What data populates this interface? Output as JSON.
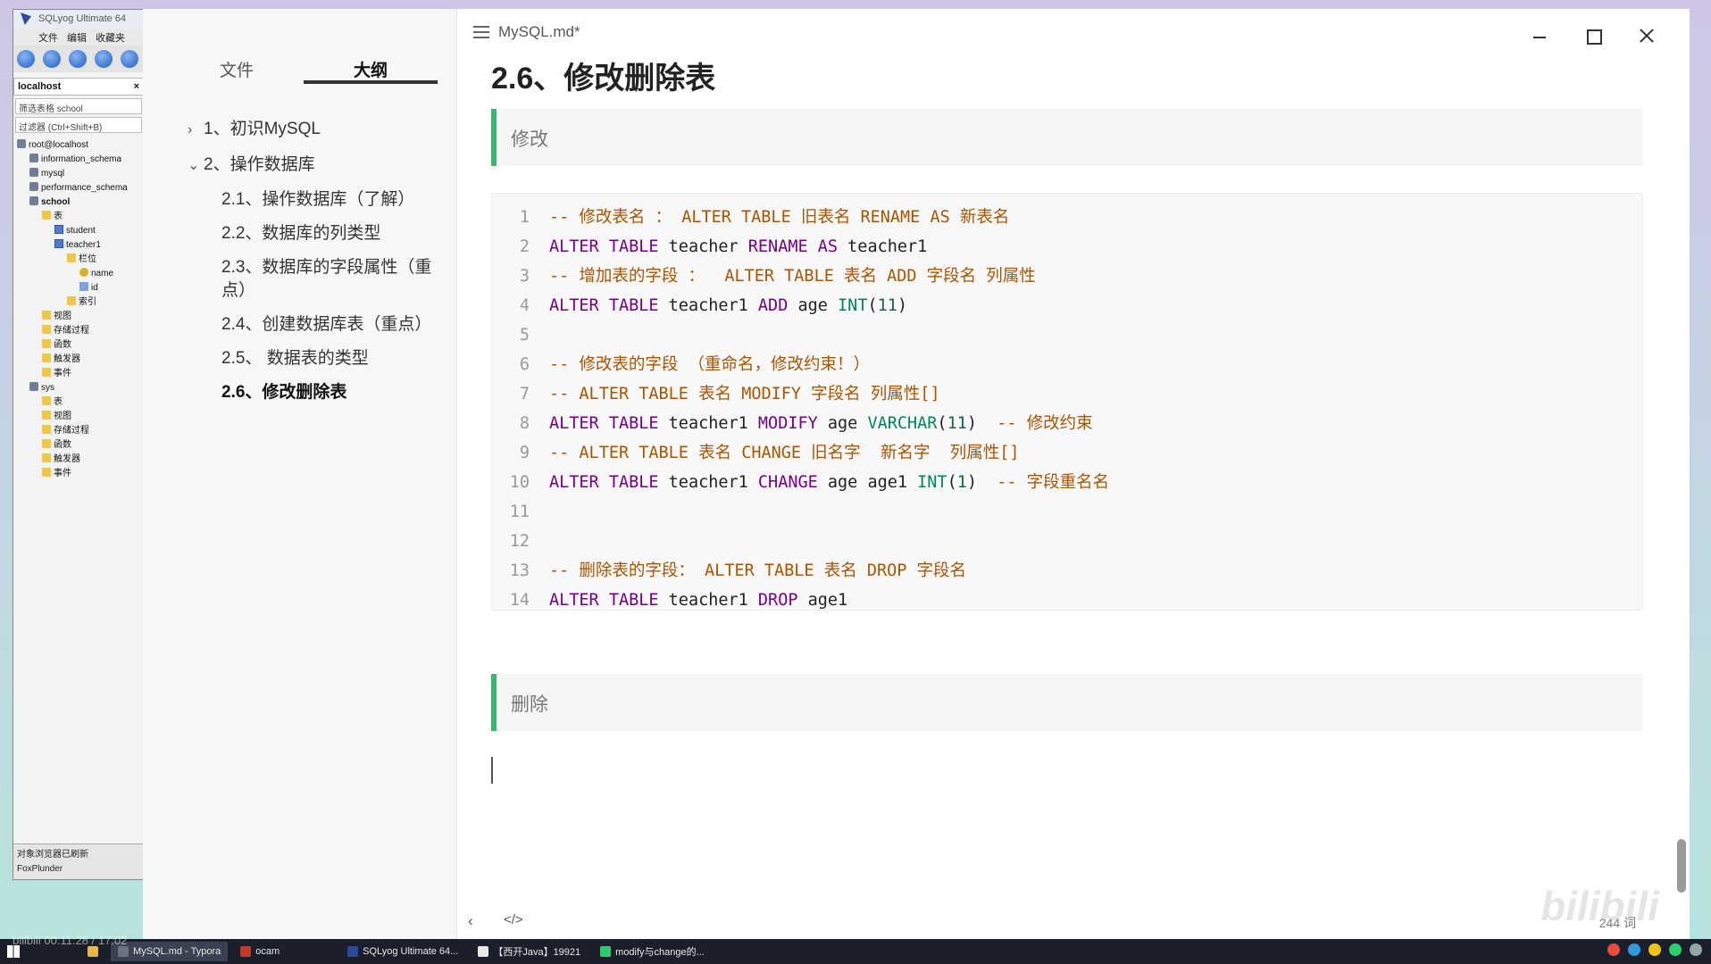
{
  "sqlyog": {
    "title": "SQLyog Ultimate 64",
    "menu": [
      "文件",
      "编辑",
      "收藏夹"
    ],
    "connection": "localhost",
    "filter_value": "筛选表格 school",
    "filter_placeholder": "过滤器 (Ctrl+Shift+B)",
    "tree": [
      {
        "label": "root@localhost",
        "icon": "db",
        "level": 0
      },
      {
        "label": "information_schema",
        "icon": "db",
        "level": 1
      },
      {
        "label": "mysql",
        "icon": "db",
        "level": 1
      },
      {
        "label": "performance_schema",
        "icon": "db",
        "level": 1
      },
      {
        "label": "school",
        "icon": "db",
        "level": 1
      },
      {
        "label": "表",
        "icon": "folder",
        "level": 2
      },
      {
        "label": "student",
        "icon": "table",
        "level": 3
      },
      {
        "label": "teacher1",
        "icon": "table",
        "level": 3
      },
      {
        "label": "栏位",
        "icon": "folder",
        "level": 4
      },
      {
        "label": "name",
        "icon": "key",
        "level": 5
      },
      {
        "label": "id",
        "icon": "col",
        "level": 5
      },
      {
        "label": "索引",
        "icon": "folder",
        "level": 4
      },
      {
        "label": "视图",
        "icon": "folder",
        "level": 2
      },
      {
        "label": "存储过程",
        "icon": "folder",
        "level": 2
      },
      {
        "label": "函数",
        "icon": "folder",
        "level": 2
      },
      {
        "label": "触发器",
        "icon": "folder",
        "level": 2
      },
      {
        "label": "事件",
        "icon": "folder",
        "level": 2
      },
      {
        "label": "sys",
        "icon": "db",
        "level": 1
      },
      {
        "label": "表",
        "icon": "folder",
        "level": 2
      },
      {
        "label": "视图",
        "icon": "folder",
        "level": 2
      },
      {
        "label": "存储过程",
        "icon": "folder",
        "level": 2
      },
      {
        "label": "函数",
        "icon": "folder",
        "level": 2
      },
      {
        "label": "触发器",
        "icon": "folder",
        "level": 2
      },
      {
        "label": "事件",
        "icon": "folder",
        "level": 2
      }
    ],
    "status_line1": "对象浏览器已刷新",
    "status_line2": "FoxPlunder"
  },
  "typora": {
    "filename": "MySQL.md*",
    "sidebar_tabs": [
      "文件",
      "大纲"
    ],
    "active_tab": "大纲",
    "outline": [
      {
        "label": "1、初识MySQL",
        "level": 1,
        "chevron": "›"
      },
      {
        "label": "2、操作数据库",
        "level": 1,
        "chevron": "⌄"
      },
      {
        "label": "2.1、操作数据库（了解）",
        "level": 2
      },
      {
        "label": "2.2、数据库的列类型",
        "level": 2
      },
      {
        "label": "2.3、数据库的字段属性（重点）",
        "level": 2
      },
      {
        "label": "2.4、创建数据库表（重点）",
        "level": 2
      },
      {
        "label": "2.5、 数据表的类型",
        "level": 2
      },
      {
        "label": "2.6、修改删除表",
        "level": 2,
        "active": true
      }
    ],
    "heading": "2.6、修改删除表",
    "quote_modify": "修改",
    "quote_delete": "删除",
    "code_lines": [
      [
        [
          "cm",
          "-- 修改表名 ： ALTER TABLE 旧表名 RENAME AS 新表名"
        ]
      ],
      [
        [
          "kw",
          "ALTER TABLE"
        ],
        [
          "plain",
          " teacher "
        ],
        [
          "kw",
          "RENAME AS"
        ],
        [
          "plain",
          " teacher1"
        ]
      ],
      [
        [
          "cm",
          "-- 增加表的字段 ：  ALTER TABLE 表名 ADD 字段名 列属性"
        ]
      ],
      [
        [
          "kw",
          "ALTER TABLE"
        ],
        [
          "plain",
          " teacher1 "
        ],
        [
          "kw",
          "ADD"
        ],
        [
          "plain",
          " age "
        ],
        [
          "type",
          "INT"
        ],
        [
          "plain",
          "("
        ],
        [
          "num",
          "11"
        ],
        [
          "plain",
          ")"
        ]
      ],
      [],
      [
        [
          "cm",
          "-- 修改表的字段 （重命名，修改约束！）"
        ]
      ],
      [
        [
          "cm",
          "-- ALTER TABLE 表名 MODIFY 字段名 列属性[]"
        ]
      ],
      [
        [
          "kw",
          "ALTER TABLE"
        ],
        [
          "plain",
          " teacher1 "
        ],
        [
          "kw",
          "MODIFY"
        ],
        [
          "plain",
          " age "
        ],
        [
          "type",
          "VARCHAR"
        ],
        [
          "plain",
          "("
        ],
        [
          "num",
          "11"
        ],
        [
          "plain",
          ")  "
        ],
        [
          "cm",
          "-- 修改约束"
        ]
      ],
      [
        [
          "cm",
          "-- ALTER TABLE 表名 CHANGE 旧名字  新名字  列属性[]"
        ]
      ],
      [
        [
          "kw",
          "ALTER TABLE"
        ],
        [
          "plain",
          " teacher1 "
        ],
        [
          "kw",
          "CHANGE"
        ],
        [
          "plain",
          " age age1 "
        ],
        [
          "type",
          "INT"
        ],
        [
          "plain",
          "("
        ],
        [
          "num",
          "1"
        ],
        [
          "plain",
          ")  "
        ],
        [
          "cm",
          "-- 字段重名名"
        ]
      ],
      [],
      [],
      [
        [
          "cm",
          "-- 删除表的字段： ALTER TABLE 表名 DROP 字段名"
        ]
      ],
      [
        [
          "kw",
          "ALTER TABLE"
        ],
        [
          "plain",
          " teacher1 "
        ],
        [
          "kw",
          "DROP"
        ],
        [
          "plain",
          " age1"
        ]
      ]
    ],
    "word_count": "244 词",
    "nav_back_icon": "chevron-left-icon",
    "source_mode_icon": "code-icon"
  },
  "taskbar": {
    "items": [
      {
        "label": "MySQL.md - Typora",
        "active": true,
        "color": "#6b7280"
      },
      {
        "label": "ocam",
        "active": false,
        "color": "#c0392b"
      },
      {
        "label": "SQLyog Ultimate 64...",
        "active": false,
        "color": "#2b4a9c"
      },
      {
        "label": "【西开Java】19921",
        "active": false,
        "color": "#e8e8e8"
      },
      {
        "label": "modify与change的...",
        "active": false,
        "color": "#2ecc71"
      }
    ],
    "overlay": "bilibili 00:11:28 / 17:02"
  },
  "colors": {
    "accent_green": "#3eb370",
    "keyword": "#770088",
    "comment": "#aa5500"
  }
}
